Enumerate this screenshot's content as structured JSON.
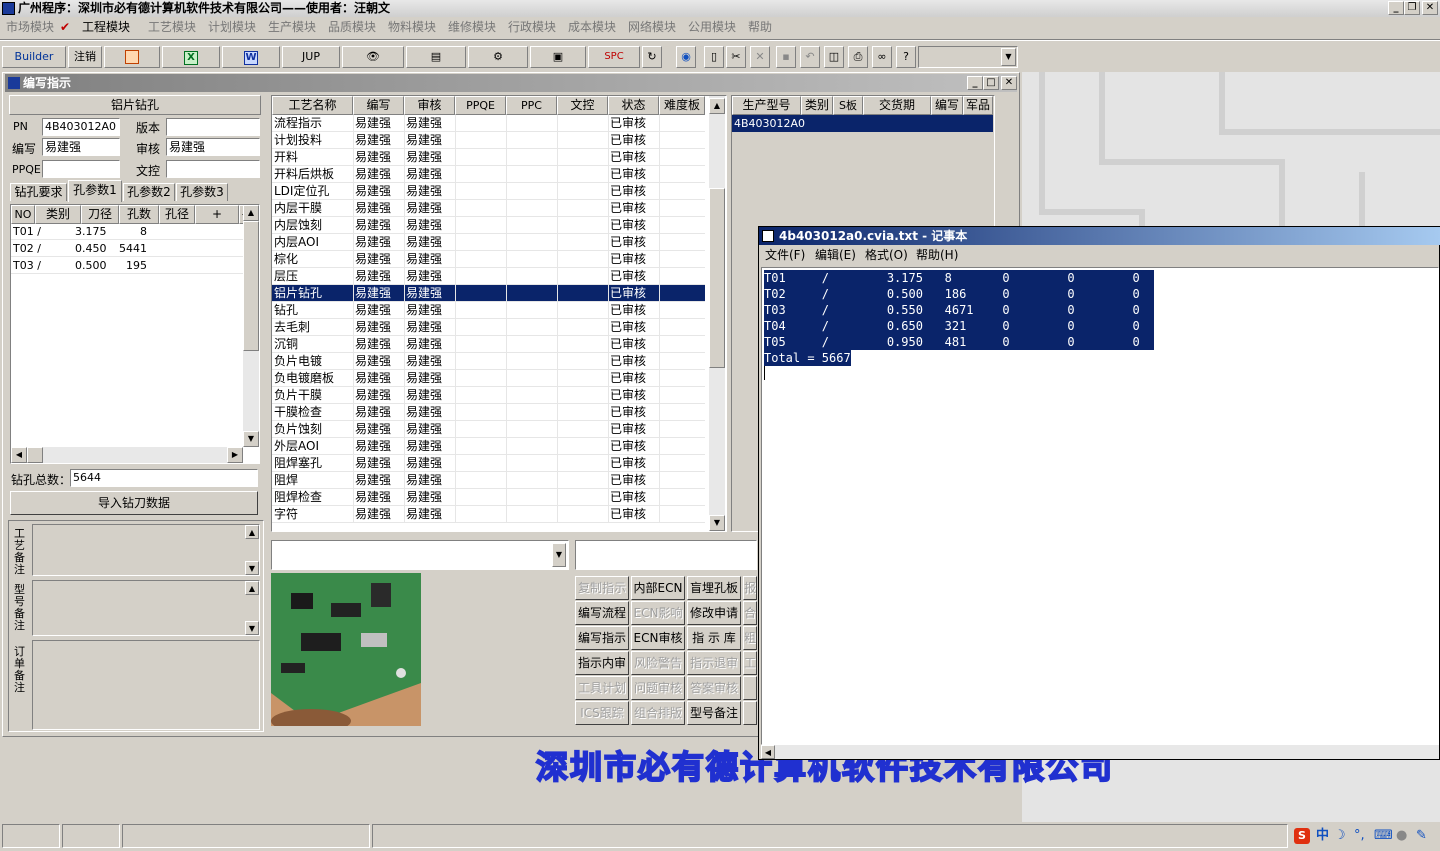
{
  "app": {
    "title": "广州程序：深圳市必有德计算机软件技术有限公司——使用者：汪朝文",
    "menu": [
      "市场模块",
      "工程模块",
      "工艺模块",
      "计划模块",
      "生产模块",
      "品质模块",
      "物料模块",
      "维修模块",
      "行政模块",
      "成本模块",
      "网络模块",
      "公用模块",
      "帮助"
    ],
    "active_menu": "工程模块"
  },
  "toolbar": {
    "builder": "Builder",
    "logout": "注销",
    "jup": "JUP",
    "spc": "SPC"
  },
  "mdi": {
    "title": "编写指示",
    "section_title": "铝片钻孔",
    "pn_label": "PN",
    "pn_value": "4B403012A0",
    "version_label": "版本",
    "version_value": "",
    "author_label": "编写",
    "author_value": "易建强",
    "review_label": "审核",
    "review_value": "易建强",
    "ppqe_label": "PPQE",
    "ppqe_value": "",
    "doc_label": "文控",
    "doc_value": "",
    "tabs": [
      "钻孔要求",
      "孔参数1",
      "孔参数2",
      "孔参数3"
    ],
    "active_tab": "孔参数1",
    "tool_cols": [
      "NO",
      "类别",
      "刀径",
      "孔数",
      "孔径",
      "+",
      "-"
    ],
    "tool_rows": [
      {
        "no": "T01 /",
        "dia": "3.175",
        "cnt": "8"
      },
      {
        "no": "T02 /",
        "dia": "0.450",
        "cnt": "5441"
      },
      {
        "no": "T03 /",
        "dia": "0.500",
        "cnt": "195"
      }
    ],
    "total_label": "钻孔总数：",
    "total_value": "5644",
    "import_btn": "导入钻刀数据",
    "notes": [
      "工艺备注",
      "型号备注",
      "订单备注"
    ]
  },
  "process": {
    "cols": [
      "工艺名称",
      "编写",
      "审核",
      "PPQE",
      "PPC",
      "文控",
      "状态",
      "难度板"
    ],
    "rows": [
      {
        "name": "流程指示",
        "author": "易建强",
        "reviewer": "易建强",
        "status": "已审核"
      },
      {
        "name": "计划投料",
        "author": "易建强",
        "reviewer": "易建强",
        "status": "已审核"
      },
      {
        "name": "开料",
        "author": "易建强",
        "reviewer": "易建强",
        "status": "已审核"
      },
      {
        "name": "开料后烘板",
        "author": "易建强",
        "reviewer": "易建强",
        "status": "已审核"
      },
      {
        "name": "LDI定位孔",
        "author": "易建强",
        "reviewer": "易建强",
        "status": "已审核"
      },
      {
        "name": "内层干膜",
        "author": "易建强",
        "reviewer": "易建强",
        "status": "已审核"
      },
      {
        "name": "内层蚀刻",
        "author": "易建强",
        "reviewer": "易建强",
        "status": "已审核"
      },
      {
        "name": "内层AOI",
        "author": "易建强",
        "reviewer": "易建强",
        "status": "已审核"
      },
      {
        "name": "棕化",
        "author": "易建强",
        "reviewer": "易建强",
        "status": "已审核"
      },
      {
        "name": "层压",
        "author": "易建强",
        "reviewer": "易建强",
        "status": "已审核"
      },
      {
        "name": "铝片钻孔",
        "author": "易建强",
        "reviewer": "易建强",
        "status": "已审核"
      },
      {
        "name": "钻孔",
        "author": "易建强",
        "reviewer": "易建强",
        "status": "已审核"
      },
      {
        "name": "去毛刺",
        "author": "易建强",
        "reviewer": "易建强",
        "status": "已审核"
      },
      {
        "name": "沉铜",
        "author": "易建强",
        "reviewer": "易建强",
        "status": "已审核"
      },
      {
        "name": "负片电镀",
        "author": "易建强",
        "reviewer": "易建强",
        "status": "已审核"
      },
      {
        "name": "负电镀磨板",
        "author": "易建强",
        "reviewer": "易建强",
        "status": "已审核"
      },
      {
        "name": "负片干膜",
        "author": "易建强",
        "reviewer": "易建强",
        "status": "已审核"
      },
      {
        "name": "干膜检查",
        "author": "易建强",
        "reviewer": "易建强",
        "status": "已审核"
      },
      {
        "name": "负片蚀刻",
        "author": "易建强",
        "reviewer": "易建强",
        "status": "已审核"
      },
      {
        "name": "外层AOI",
        "author": "易建强",
        "reviewer": "易建强",
        "status": "已审核"
      },
      {
        "name": "阻焊塞孔",
        "author": "易建强",
        "reviewer": "易建强",
        "status": "已审核"
      },
      {
        "name": "阻焊",
        "author": "易建强",
        "reviewer": "易建强",
        "status": "已审核"
      },
      {
        "name": "阻焊检查",
        "author": "易建强",
        "reviewer": "易建强",
        "status": "已审核"
      },
      {
        "name": "字符",
        "author": "易建强",
        "reviewer": "易建强",
        "status": "已审核"
      }
    ],
    "selected_index": 10
  },
  "models": {
    "cols": [
      "生产型号",
      "类别",
      "S板",
      "交货期",
      "编写",
      "军品"
    ],
    "rows": [
      {
        "model": "4B403012A0"
      }
    ]
  },
  "actions": [
    {
      "label": "复制指示",
      "enabled": false
    },
    {
      "label": "内部ECN",
      "enabled": true
    },
    {
      "label": "盲埋孔板",
      "enabled": true
    },
    {
      "label": "报",
      "enabled": false
    },
    {
      "label": "编写流程",
      "enabled": true
    },
    {
      "label": "ECN影响",
      "enabled": false
    },
    {
      "label": "修改申请",
      "enabled": true
    },
    {
      "label": "合",
      "enabled": false
    },
    {
      "label": "编写指示",
      "enabled": true
    },
    {
      "label": "ECN审核",
      "enabled": true
    },
    {
      "label": "指 示 库",
      "enabled": true
    },
    {
      "label": "粗",
      "enabled": false
    },
    {
      "label": "指示内审",
      "enabled": true
    },
    {
      "label": "风险警告",
      "enabled": false
    },
    {
      "label": "指示退审",
      "enabled": false
    },
    {
      "label": "工",
      "enabled": false
    },
    {
      "label": "工具计划",
      "enabled": false
    },
    {
      "label": "问题审核",
      "enabled": false
    },
    {
      "label": "答案审核",
      "enabled": false
    },
    {
      "label": "",
      "enabled": false
    },
    {
      "label": "ICS跟踪",
      "enabled": false
    },
    {
      "label": "组合排版",
      "enabled": false
    },
    {
      "label": "型号备注",
      "enabled": true
    },
    {
      "label": "",
      "enabled": false
    }
  ],
  "banner": "深圳市必有德计算机软件技术有限公司",
  "notepad": {
    "title": "4b403012a0.cvia.txt - 记事本",
    "menu": [
      "文件(F)",
      "编辑(E)",
      "格式(O)",
      "帮助(H)"
    ],
    "lines": [
      "T01     /        3.175   8       0        0        0",
      "T02     /        0.500   186     0        0        0",
      "T03     /        0.550   4671    0        0        0",
      "T04     /        0.650   321     0        0        0",
      "T05     /        0.950   481     0        0        0",
      "Total = 5667"
    ]
  },
  "tray": {
    "ime": "中"
  }
}
